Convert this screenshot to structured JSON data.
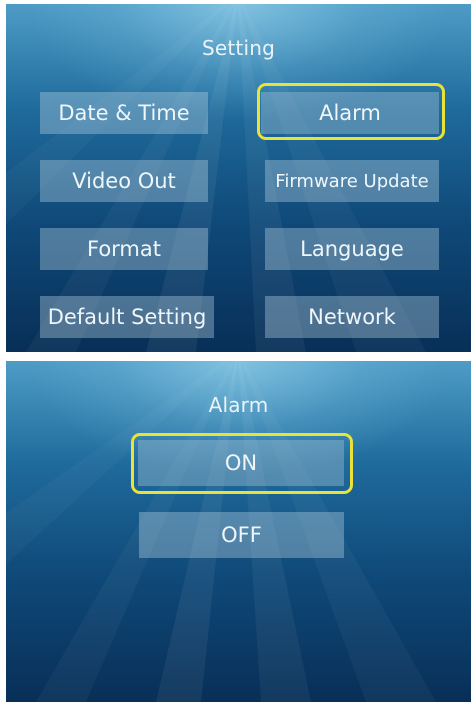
{
  "setting_screen": {
    "title": "Setting",
    "buttons": [
      {
        "label": "Date & Time"
      },
      {
        "label": "Alarm"
      },
      {
        "label": "Video Out"
      },
      {
        "label": "Firmware Update"
      },
      {
        "label": "Format"
      },
      {
        "label": "Language"
      },
      {
        "label": "Default Setting"
      },
      {
        "label": "Network"
      }
    ],
    "selected": "Alarm"
  },
  "alarm_screen": {
    "title": "Alarm",
    "options": [
      {
        "label": "ON"
      },
      {
        "label": "OFF"
      }
    ],
    "selected": "ON"
  },
  "colors": {
    "highlight": "#e8e23a",
    "background_top": "#4e9cc6",
    "background_bottom": "#082f57"
  }
}
